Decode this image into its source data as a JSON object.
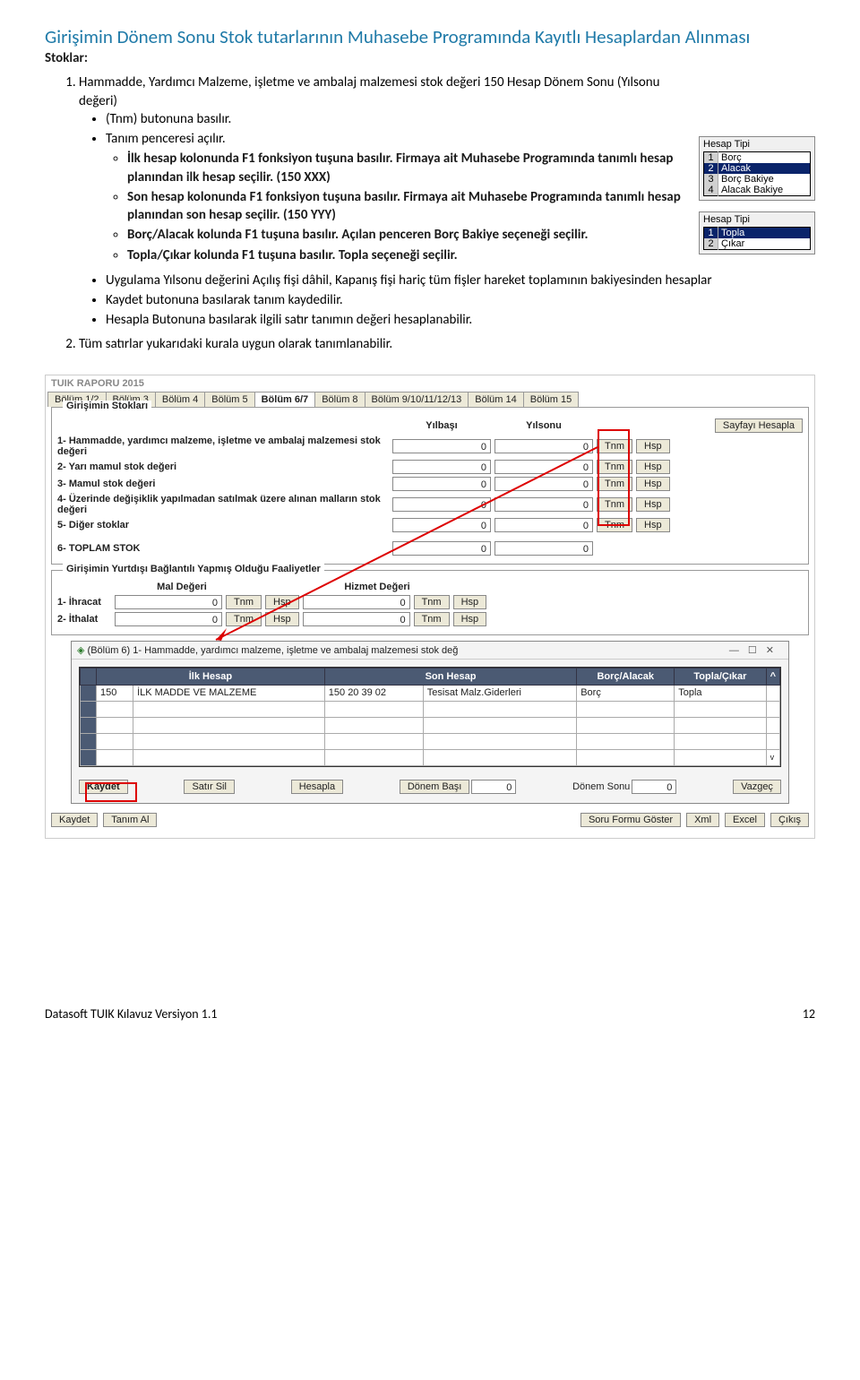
{
  "title": "Girişimin Dönem Sonu Stok tutarlarının Muhasebe Programında Kayıtlı Hesaplardan Alınması",
  "stoklar": "Stoklar:",
  "li1_intro": "Hammadde, Yardımcı Malzeme, işletme ve ambalaj malzemesi stok değeri 150 Hesap Dönem Sonu (Yılsonu değeri)",
  "b1": "(Tnm) butonuna basılır.",
  "b2": "Tanım penceresi açılır.",
  "s1": "İlk hesap kolonunda F1 fonksiyon tuşuna basılır. Firmaya ait Muhasebe Programında tanımlı hesap planından ilk hesap seçilir. (150 XXX)",
  "s2": "Son hesap kolonunda F1 fonksiyon tuşuna basılır. Firmaya ait Muhasebe Programında tanımlı hesap planından son hesap seçilir. (150 YYY)",
  "s3": "Borç/Alacak kolunda F1 tuşuna basılır. Açılan penceren Borç Bakiye seçeneği seçilir.",
  "s4": "Topla/Çıkar kolunda F1 tuşuna basılır. Topla seçeneği seçilir.",
  "b3": "Uygulama Yılsonu değerini Açılış fişi dâhil, Kapanış fişi hariç tüm fişler hareket toplamının bakiyesinden hesaplar",
  "b4": "Kaydet butonuna basılarak tanım kaydedilir.",
  "b5": "Hesapla Butonuna basılarak ilgili satır tanımın değeri hesaplanabilir.",
  "li2": "Tüm satırlar yukarıdaki kurala uygun olarak tanımlanabilir.",
  "hb1": {
    "caption": "Hesap Tipi",
    "r1": "Borç",
    "r2": "Alacak",
    "r3": "Borç Bakiye",
    "r4": "Alacak Bakiye"
  },
  "hb2": {
    "caption": "Hesap Tipi",
    "r1": "Topla",
    "r2": "Çıkar"
  },
  "ss": {
    "title": "TUIK RAPORU 2015",
    "tabs": [
      "Bölüm 1/2",
      "Bölüm 3",
      "Bölüm 4",
      "Bölüm 5",
      "Bölüm 6/7",
      "Bölüm 8",
      "Bölüm 9/10/11/12/13",
      "Bölüm 14",
      "Bölüm 15"
    ],
    "panel1": "Girişimin Stokları",
    "col1": "Yılbaşı",
    "col2": "Yılsonu",
    "btnCalc": "Sayfayı Hesapla",
    "rows": [
      "1- Hammadde, yardımcı malzeme, işletme ve ambalaj malzemesi stok değeri",
      "2- Yarı mamul stok değeri",
      "3- Mamul stok değeri",
      "4- Üzerinde değişiklik yapılmadan satılmak üzere alınan malların stok değeri",
      "5- Diğer stoklar",
      "6- TOPLAM STOK"
    ],
    "v0": "0",
    "tnm": "Tnm",
    "hsp": "Hsp",
    "panel2": "Girişimin Yurtdışı Bağlantılı Yapmış Olduğu Faaliyetler",
    "mal": "Mal Değeri",
    "hiz": "Hizmet Değeri",
    "ihr": "1- İhracat",
    "ith": "2- İthalat"
  },
  "modal": {
    "title": "(Bölüm 6)  1- Hammadde, yardımcı malzeme, işletme ve ambalaj malzemesi stok değ",
    "min": "—",
    "max": "☐",
    "close": "✕",
    "h1": "İlk Hesap",
    "h2": "Son Hesap",
    "h3": "Borç/Alacak",
    "h4": "Topla/Çıkar",
    "c1a": "150",
    "c1b": "İLK MADDE VE MALZEME",
    "c1c": "150 20 39 02",
    "c1d": "Tesisat Malz.Giderleri",
    "c1e": "Borç",
    "c1f": "Topla",
    "kaydet": "Kaydet",
    "satirsil": "Satır Sil",
    "hesapla": "Hesapla",
    "donembasi": "Dönem Başı",
    "donemsonu": "Dönem Sonu",
    "vazgec": "Vazgeç",
    "zero": "0"
  },
  "bottom": {
    "kaydet": "Kaydet",
    "tanimal": "Tanım Al",
    "soru": "Soru Formu Göster",
    "xml": "Xml",
    "excel": "Excel",
    "cikis": "Çıkış"
  },
  "footer_left": "Datasoft TUIK Kılavuz Versiyon 1.1",
  "footer_right": "12"
}
